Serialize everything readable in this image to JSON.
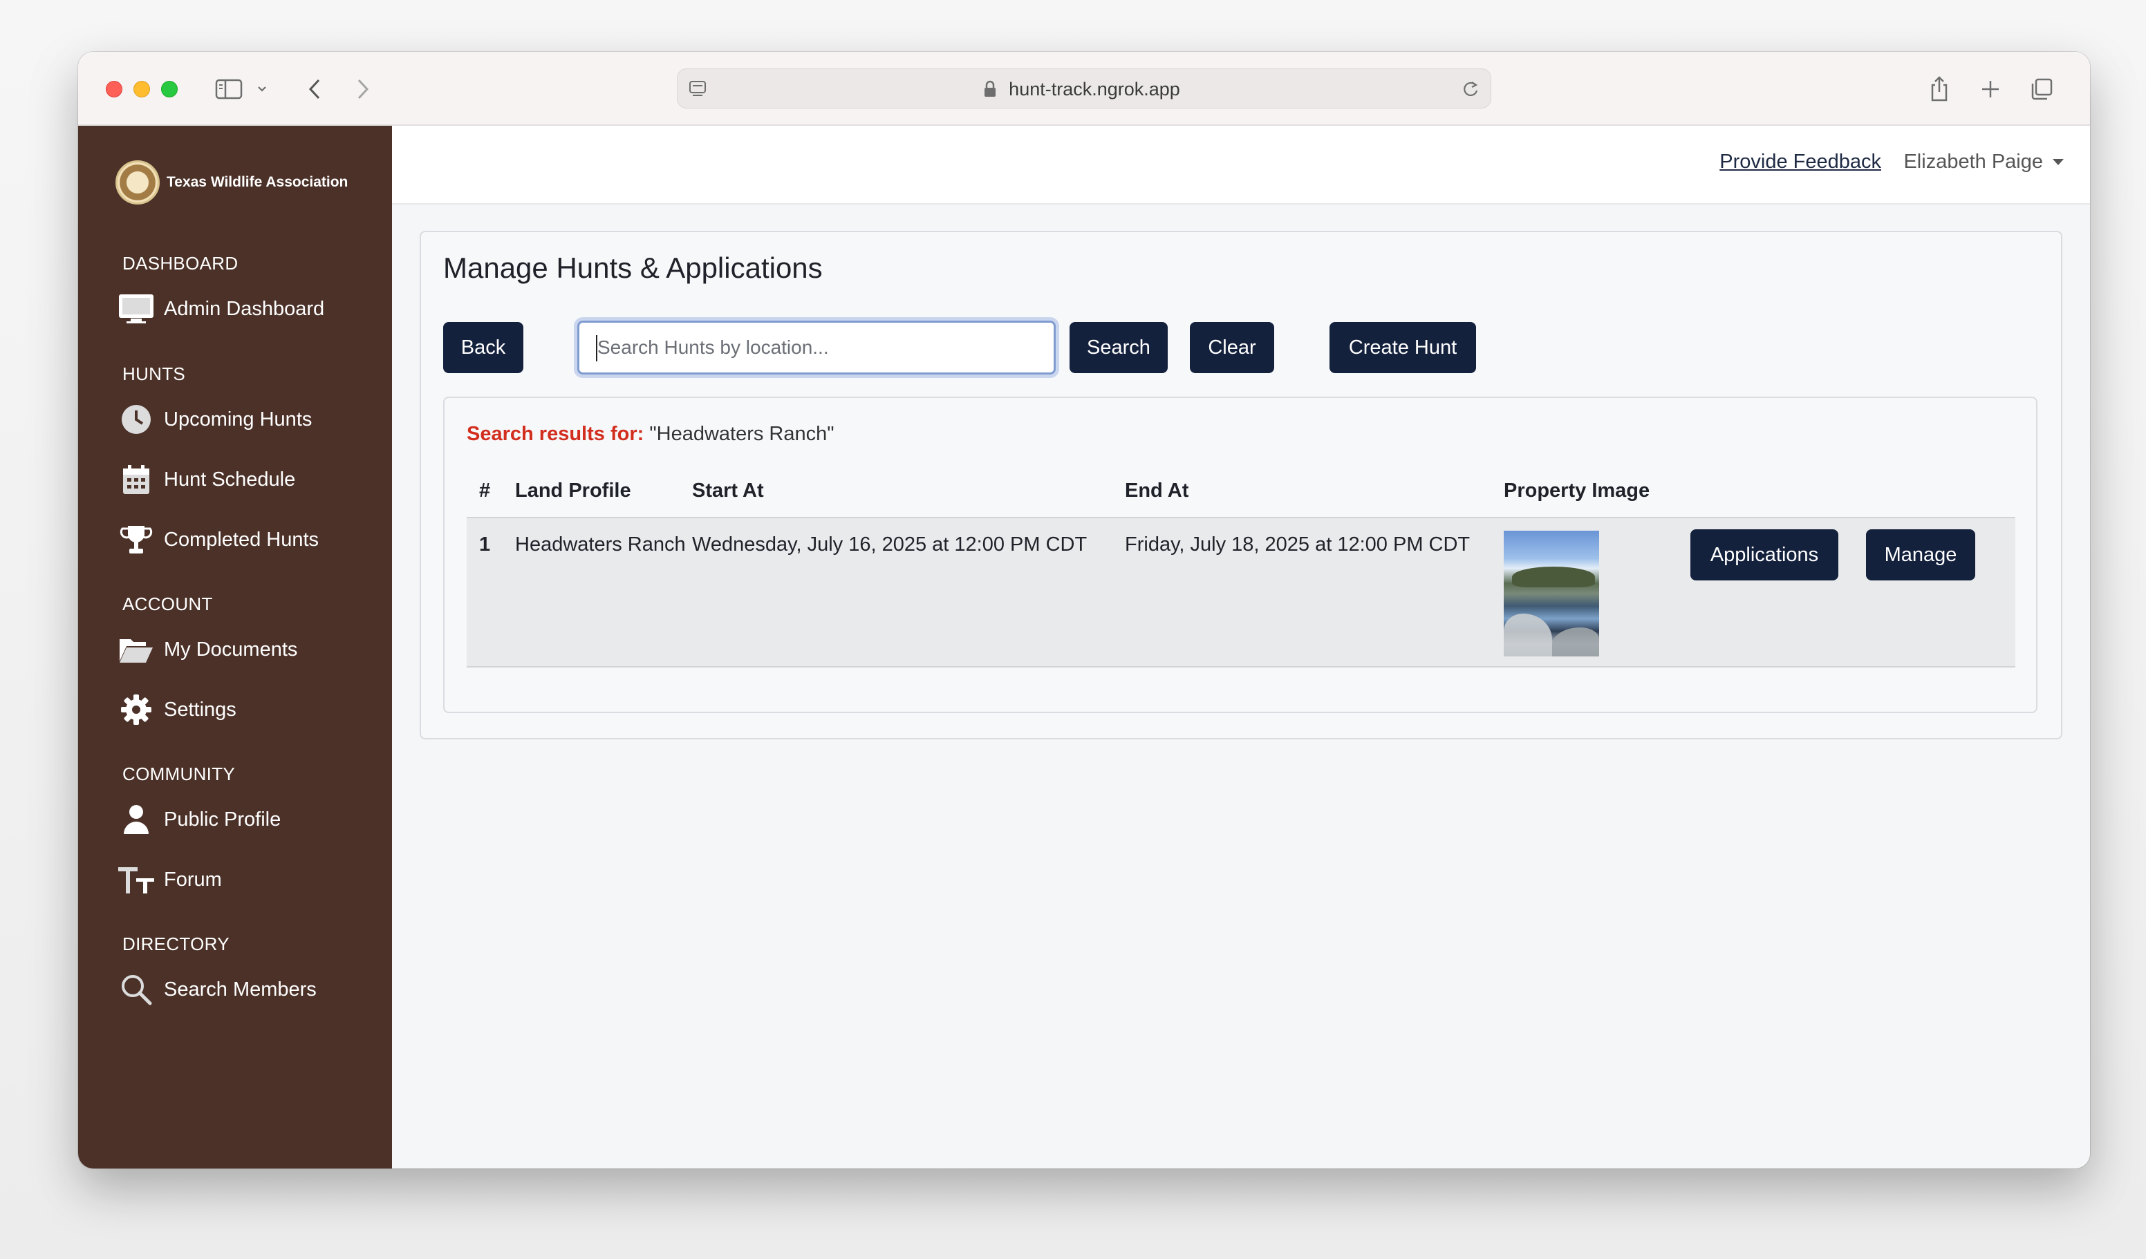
{
  "browser": {
    "url": "hunt-track.ngrok.app"
  },
  "sidebar": {
    "brand": "Texas Wildlife Association",
    "sections": [
      {
        "header": "DASHBOARD",
        "items": [
          {
            "label": "Admin Dashboard",
            "icon": "monitor-icon"
          }
        ]
      },
      {
        "header": "HUNTS",
        "items": [
          {
            "label": "Upcoming Hunts",
            "icon": "clock-icon"
          },
          {
            "label": "Hunt Schedule",
            "icon": "calendar-icon"
          },
          {
            "label": "Completed Hunts",
            "icon": "trophy-icon"
          }
        ]
      },
      {
        "header": "ACCOUNT",
        "items": [
          {
            "label": "My Documents",
            "icon": "folder-open-icon"
          },
          {
            "label": "Settings",
            "icon": "gear-icon"
          }
        ]
      },
      {
        "header": "COMMUNITY",
        "items": [
          {
            "label": "Public Profile",
            "icon": "user-icon"
          },
          {
            "label": "Forum",
            "icon": "text-size-icon"
          }
        ]
      },
      {
        "header": "DIRECTORY",
        "items": [
          {
            "label": "Search Members",
            "icon": "search-icon"
          }
        ]
      }
    ]
  },
  "topbar": {
    "feedback": "Provide Feedback",
    "user": "Elizabeth Paige"
  },
  "main": {
    "title": "Manage Hunts & Applications",
    "back_label": "Back",
    "search_placeholder": "Search Hunts by location...",
    "search_label": "Search",
    "clear_label": "Clear",
    "create_label": "Create Hunt",
    "results_label": "Search results for:",
    "results_query": "\"Headwaters Ranch\"",
    "columns": [
      "#",
      "Land Profile",
      "Start At",
      "End At",
      "Property Image"
    ],
    "rows": [
      {
        "num": "1",
        "land_profile": "Headwaters Ranch",
        "start_at": "Wednesday, July 16, 2025 at 12:00 PM CDT",
        "end_at": "Friday, July 18, 2025 at 12:00 PM CDT",
        "applications_label": "Applications",
        "manage_label": "Manage"
      }
    ]
  },
  "colors": {
    "sidebar": "#4b3128",
    "button": "#14213d",
    "results_label": "#d22e1e"
  }
}
